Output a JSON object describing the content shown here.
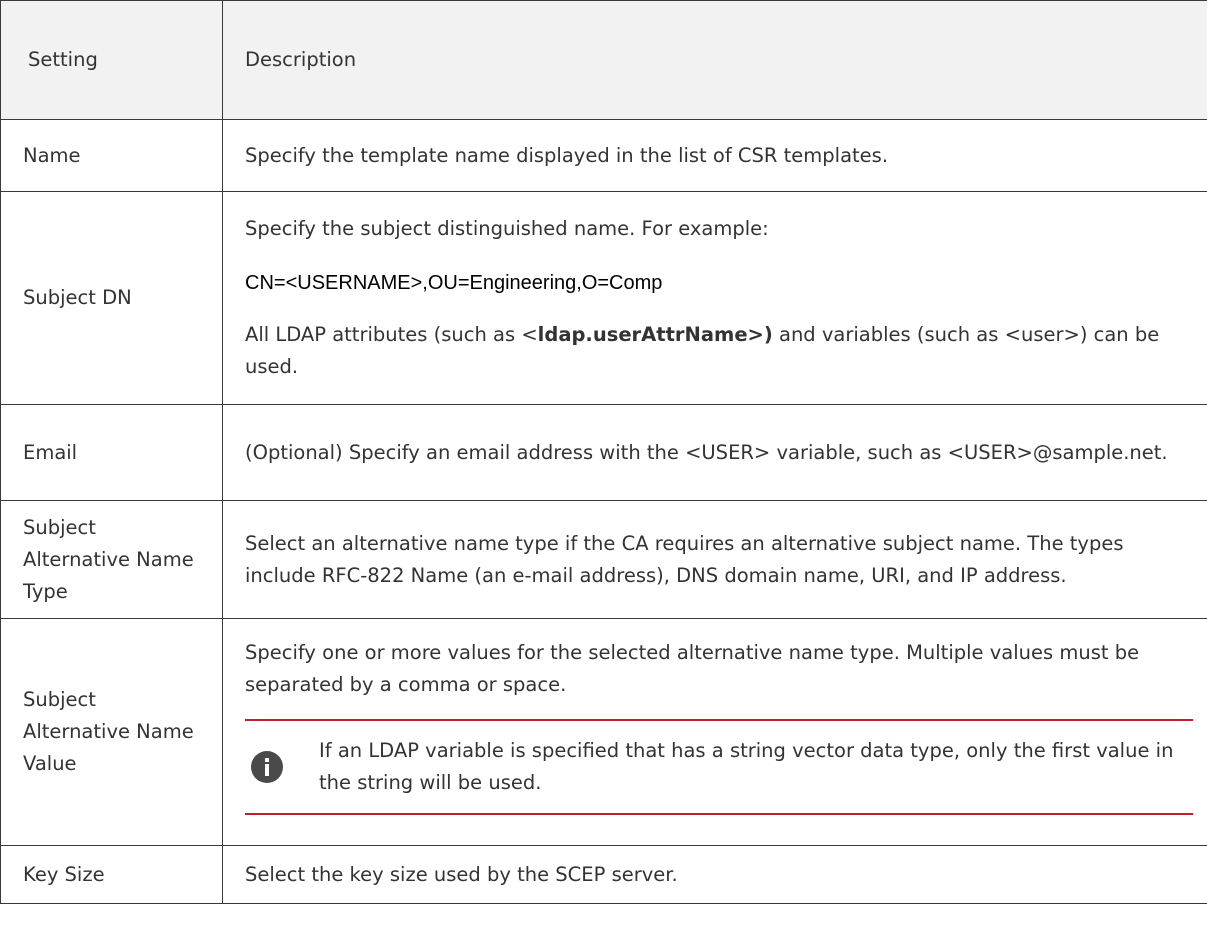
{
  "table": {
    "header": {
      "setting": "Setting",
      "description": "Description"
    },
    "rows": [
      {
        "setting": "Name",
        "description": "Specify the template name displayed in the list of CSR templates."
      },
      {
        "setting": "Subject DN",
        "description_intro": "Specify the subject distinguished name. For example:",
        "example": "CN=<USERNAME>,OU=Engineering,O=Comp",
        "description_pre": "All LDAP attributes (such as <",
        "description_bold": "ldap.userAttrName>)",
        "description_post": " and variables (such as <user>) can be used."
      },
      {
        "setting": "Email",
        "description": "(Optional) Specify an email address with the <USER> variable, such as <USER>@sample.net."
      },
      {
        "setting": "Subject Alternative Name Type",
        "description": "Select an alternative name type if the CA requires an alternative subject name. The types include RFC-822 Name (an e-mail address), DNS domain name, URI, and IP address."
      },
      {
        "setting": "Subject Alternative Name Value",
        "description": "Specify one or more values for the selected alternative name type. Multiple values must be separated by a comma or space.",
        "note": "If an LDAP variable is specified that has a string vector data type, only the first value in the string will be used.",
        "note_icon": "info-icon"
      },
      {
        "setting": "Key Size",
        "description": "Select the key size used by the SCEP server."
      }
    ]
  },
  "colors": {
    "note_rule": "#c21f2d",
    "header_bg": "#f2f2f2",
    "border": "#3a3a3a",
    "text": "#333333"
  }
}
